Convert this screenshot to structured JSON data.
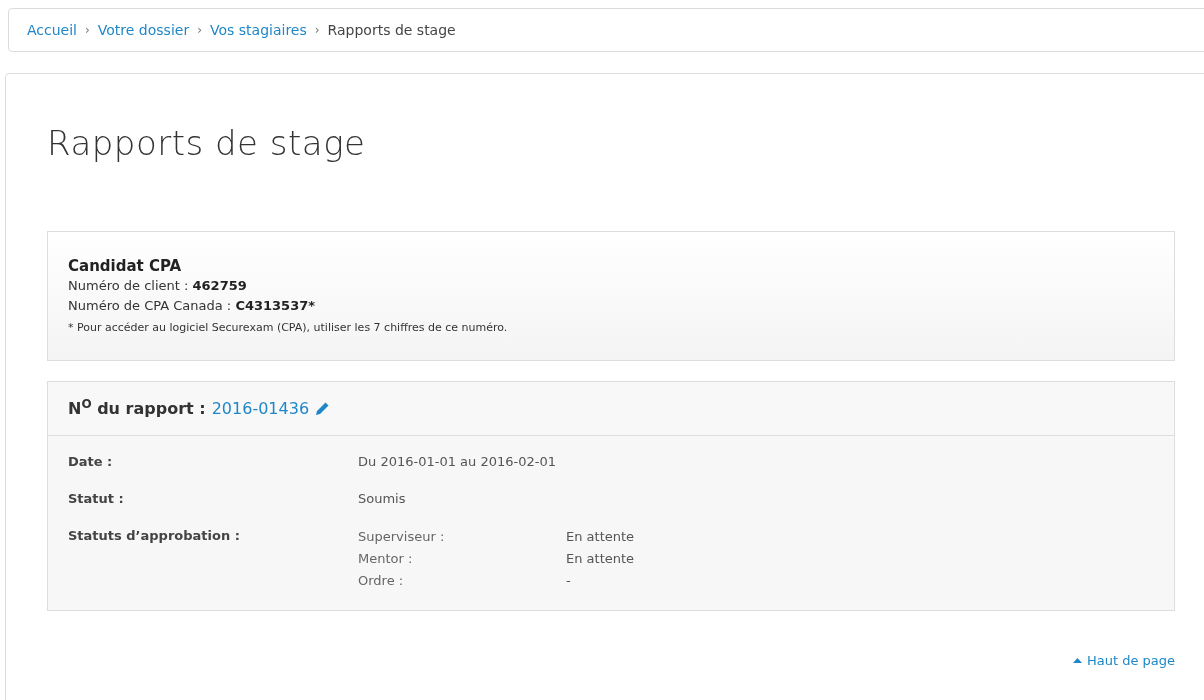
{
  "breadcrumb": [
    {
      "label": "Accueil",
      "current": false
    },
    {
      "label": "Votre dossier",
      "current": false
    },
    {
      "label": "Vos stagiaires",
      "current": false
    },
    {
      "label": "Rapports de stage",
      "current": true
    }
  ],
  "breadcrumb_separator": "›",
  "page_title": "Rapports de stage",
  "candidate": {
    "title": "Candidat CPA",
    "fields": [
      {
        "label": "Numéro de client : ",
        "value": "462759"
      },
      {
        "label": "Numéro de CPA Canada : ",
        "value": "C4313537*"
      }
    ],
    "note": "* Pour accéder au logiciel Securexam (CPA), utiliser les 7 chiffres de ce numéro."
  },
  "report": {
    "label": "N$^{O}$ du rapport :",
    "number": "2016-01436",
    "rows": [
      {
        "label": "Date :",
        "value": "Du 2016-01-01 au 2016-02-01"
      },
      {
        "label": "Statut :",
        "value": "Soumis"
      }
    ],
    "approval": {
      "label": "Statuts d’approbation :",
      "items": [
        {
          "role": "Superviseur :",
          "status": "En attente"
        },
        {
          "role": "Mentor :",
          "status": "En attente"
        },
        {
          "role": "Ordre :",
          "status": "-"
        }
      ]
    }
  },
  "back_to_top": "Haut de page"
}
